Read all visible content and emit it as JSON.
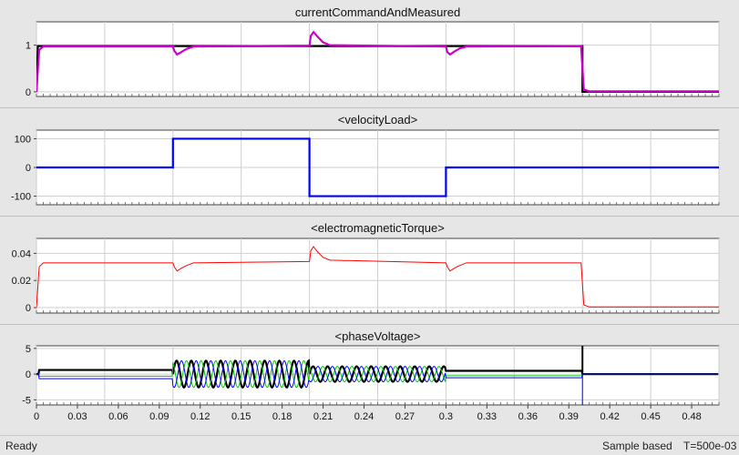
{
  "chart_data": [
    {
      "type": "line",
      "title": "currentCommandAndMeasured",
      "xlim": [
        0,
        0.5
      ],
      "ylim": [
        -0.1,
        1.5
      ],
      "yticks": [
        0,
        1
      ],
      "ytick_labels": [
        "0",
        "1"
      ],
      "grid": true,
      "series": [
        {
          "color": "#000000",
          "x": [
            0,
            0.001,
            0.4,
            0.4,
            0.5
          ],
          "y": [
            0,
            0.98,
            0.98,
            0,
            0
          ]
        },
        {
          "color": "#cc00cc",
          "x": [
            0,
            0.002,
            0.005,
            0.1,
            0.101,
            0.103,
            0.106,
            0.11,
            0.115,
            0.2,
            0.201,
            0.203,
            0.206,
            0.21,
            0.215,
            0.3,
            0.301,
            0.303,
            0.306,
            0.31,
            0.315,
            0.399,
            0.401,
            0.405,
            0.5
          ],
          "y": [
            0,
            0.9,
            0.97,
            0.97,
            0.88,
            0.8,
            0.85,
            0.92,
            0.97,
            0.99,
            1.2,
            1.28,
            1.18,
            1.06,
            1.0,
            0.97,
            0.85,
            0.8,
            0.86,
            0.93,
            0.97,
            0.98,
            0.05,
            0.01,
            0.01
          ]
        }
      ]
    },
    {
      "type": "line",
      "title": "<velocityLoad>",
      "xlim": [
        0,
        0.5
      ],
      "ylim": [
        -130,
        130
      ],
      "yticks": [
        -100,
        0,
        100
      ],
      "ytick_labels": [
        "-100",
        "0",
        "100"
      ],
      "grid": true,
      "series": [
        {
          "color": "#0000ff",
          "x": [
            0,
            0.1,
            0.1,
            0.2,
            0.2,
            0.3,
            0.3,
            0.5
          ],
          "y": [
            0,
            0,
            100,
            100,
            -100,
            -100,
            0,
            0
          ]
        }
      ]
    },
    {
      "type": "line",
      "title": "<electromagneticTorque>",
      "xlim": [
        0,
        0.5
      ],
      "ylim": [
        -0.004,
        0.051
      ],
      "yticks": [
        0,
        0.02,
        0.04
      ],
      "ytick_labels": [
        "0",
        "0.02",
        "0.04"
      ],
      "grid": true,
      "series": [
        {
          "color": "#ff0000",
          "x": [
            0,
            0.002,
            0.005,
            0.1,
            0.101,
            0.103,
            0.106,
            0.11,
            0.115,
            0.2,
            0.201,
            0.203,
            0.206,
            0.21,
            0.215,
            0.3,
            0.301,
            0.303,
            0.306,
            0.31,
            0.315,
            0.399,
            0.401,
            0.405,
            0.5
          ],
          "y": [
            0,
            0.03,
            0.033,
            0.033,
            0.03,
            0.027,
            0.029,
            0.031,
            0.033,
            0.034,
            0.042,
            0.045,
            0.041,
            0.037,
            0.035,
            0.033,
            0.03,
            0.027,
            0.029,
            0.031,
            0.033,
            0.033,
            0.002,
            0.0005,
            0.0005
          ]
        }
      ]
    },
    {
      "type": "line",
      "title": "<phaseVoltage>",
      "xlim": [
        0,
        0.5
      ],
      "ylim": [
        -6,
        5.5
      ],
      "yticks": [
        -5,
        0,
        5
      ],
      "ytick_labels": [
        "-5",
        "0",
        "5"
      ],
      "xticks": [
        0,
        0.03,
        0.06,
        0.09,
        0.12,
        0.15,
        0.18,
        0.21,
        0.24,
        0.27,
        0.3,
        0.33,
        0.36,
        0.39,
        0.42,
        0.45,
        0.48
      ],
      "xtick_labels": [
        "0",
        "0.03",
        "0.06",
        "0.09",
        "0.12",
        "0.15",
        "0.18",
        "0.21",
        "0.24",
        "0.27",
        "0.3",
        "0.33",
        "0.36",
        "0.39",
        "0.42",
        "0.45",
        "0.48"
      ],
      "grid": true,
      "waveforms": {
        "baseline_offsets": [
          0.8,
          -0.4,
          -0.9
        ],
        "segment_1": {
          "t_start": 0.1,
          "t_end": 0.2,
          "amplitude": 2.6,
          "frequency_hz": 93
        },
        "segment_2": {
          "t_start": 0.2,
          "t_end": 0.3,
          "amplitude": 1.5,
          "frequency_hz": 94
        },
        "spike_time": 0.4,
        "spike_min": -6,
        "spike_max": 5.5
      },
      "series": [
        {
          "color": "#000000",
          "phase_deg": 0
        },
        {
          "color": "#00cc00",
          "phase_deg": 120
        },
        {
          "color": "#0000ff",
          "phase_deg": 240
        }
      ]
    }
  ],
  "status": {
    "left": "Ready",
    "mode": "Sample based",
    "time": "T=500e-03"
  }
}
